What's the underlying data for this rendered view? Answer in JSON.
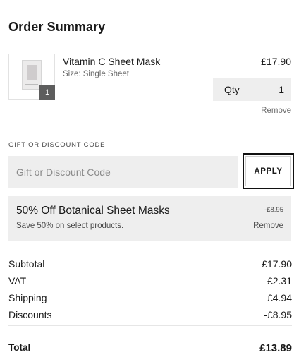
{
  "title": "Order Summary",
  "item": {
    "name": "Vitamin C Sheet Mask",
    "size": "Size: Single Sheet",
    "price": "£17.90",
    "badge_qty": "1",
    "qty_label": "Qty",
    "qty_value": "1",
    "remove_label": "Remove"
  },
  "discount": {
    "label": "GIFT OR DISCOUNT CODE",
    "placeholder": "Gift or Discount Code",
    "apply_label": "APPLY"
  },
  "promo": {
    "title": "50% Off Botanical Sheet Masks",
    "description": "Save 50% on select products.",
    "amount": "-£8.95",
    "remove_label": "Remove"
  },
  "totals": {
    "subtotal_label": "Subtotal",
    "subtotal_value": "£17.90",
    "vat_label": "VAT",
    "vat_value": "£2.31",
    "shipping_label": "Shipping",
    "shipping_value": "£4.94",
    "discounts_label": "Discounts",
    "discounts_value": "-£8.95",
    "total_label": "Total",
    "total_value": "£13.89"
  }
}
